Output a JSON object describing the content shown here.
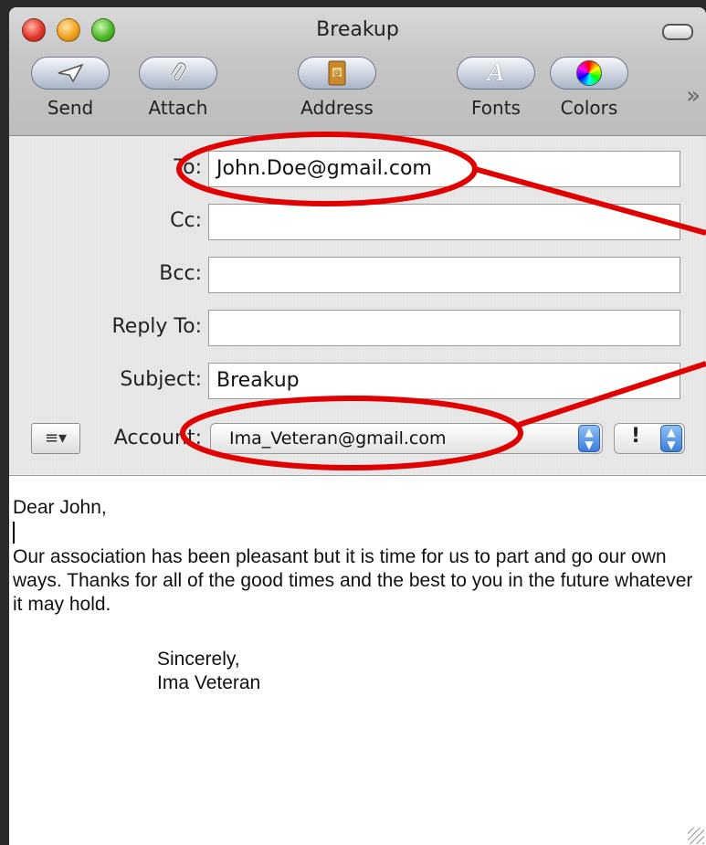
{
  "window": {
    "title": "Breakup"
  },
  "toolbar": {
    "buttons": [
      {
        "label": "Send",
        "icon": "send-icon"
      },
      {
        "label": "Attach",
        "icon": "paperclip-icon"
      },
      {
        "label": "Address",
        "icon": "address-book-icon"
      },
      {
        "label": "Fonts",
        "icon": "fonts-icon"
      },
      {
        "label": "Colors",
        "icon": "color-wheel-icon"
      }
    ],
    "overflow": "»"
  },
  "header": {
    "to_label": "To:",
    "to_value": "John.Doe@gmail.com",
    "cc_label": "Cc:",
    "cc_value": "",
    "bcc_label": "Bcc:",
    "bcc_value": "",
    "reply_to_label": "Reply To:",
    "reply_to_value": "",
    "subject_label": "Subject:",
    "subject_value": "Breakup",
    "account_label": "Account:",
    "account_value": "Ima_Veteran@gmail.com",
    "priority_value": "!",
    "format_button": "≡▾"
  },
  "message": {
    "greeting": "Dear John,",
    "paragraph": "Our association has been pleasant but it is time for us to part and go our own ways. Thanks for all of the good times and the best to you in the future whatever it may hold.",
    "closing": "Sincerely,",
    "signature": "Ima Veteran"
  },
  "annotation_color": "#e00000"
}
